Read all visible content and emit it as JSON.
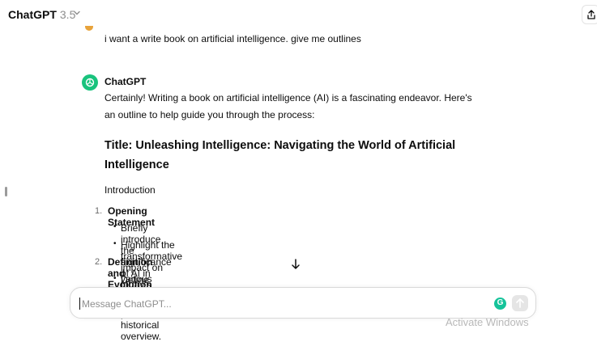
{
  "header": {
    "model_name": "ChatGPT",
    "model_version": "3.5",
    "chevron_icon": "chevron-down-icon",
    "share_icon": "share-icon"
  },
  "conversation": {
    "user_message": "i want a write book on artificial intelligence. give me outlines",
    "assistant": {
      "name": "ChatGPT",
      "intro_lines": [
        "Certainly! Writing a book on artificial intelligence (AI) is a fascinating endeavor. Here's",
        "an outline to help guide you through the process:"
      ],
      "book_title_lines": [
        "Title: Unleashing Intelligence: Navigating the World of Artificial",
        "Intelligence"
      ],
      "section": "Introduction",
      "items": [
        {
          "number": "1.",
          "title": "Opening Statement",
          "bullets": [
            "Briefly introduce the significance of AI in today's world.",
            "Highlight the transformative impact on various industries."
          ]
        },
        {
          "number": "2.",
          "title": "Definition and Evolution of AI",
          "bullets": [
            "Define what AI is and provide a historical overview."
          ]
        }
      ]
    }
  },
  "composer": {
    "placeholder": "Message ChatGPT...",
    "grammar_badge": "G",
    "send_icon": "arrow-up-icon",
    "scroll_icon": "arrow-down-icon"
  },
  "watermark": "Activate Windows",
  "colors": {
    "accent_green": "#19c37d",
    "grammarly_green": "#15c39a",
    "user_avatar": "#e8a33b"
  }
}
